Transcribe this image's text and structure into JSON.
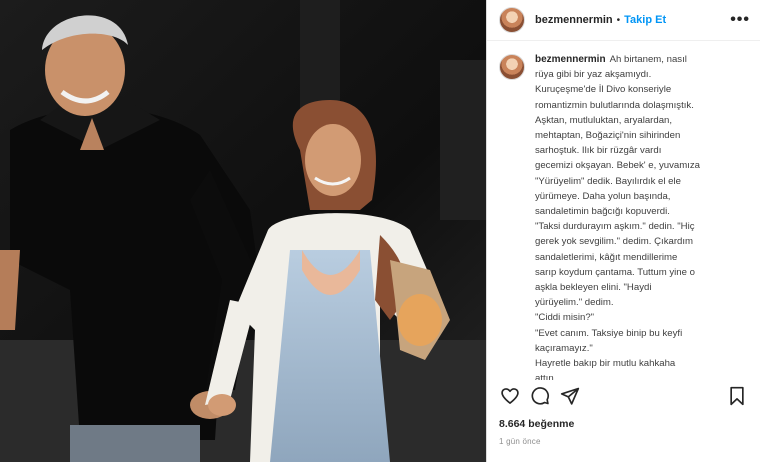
{
  "post": {
    "username": "bezmennermin",
    "separator": "•",
    "follow_label": "Takip Et",
    "more_label": "•••",
    "caption_username": "bezmennermin",
    "caption_lines": [
      "Ah birtanem, nasıl",
      "rüya gibi bir yaz akşamıydı.",
      "Kuruçeşme'de İl Divo konseriyle",
      "romantizmin bulutlarında dolaşmıştık.",
      "Aşktan, mutluluktan, aryalardan,",
      "mehtaptan, Boğaziçi'nin sihirinden",
      "sarhoştuk. Ilık bir rüzgâr vardı",
      "gecemizi okşayan. Bebek' e, yuvamıza",
      "\"Yürüyelim\" dedik. Bayılırdık el ele",
      "yürümeye. Daha yolun başında,",
      "sandaletimin bağcığı kopuverdi.",
      "\"Taksi durdurayım aşkım.\" dedin. \"Hiç",
      "gerek yok sevgilim.\" dedim. Çıkardım",
      "sandaletlerimi, kâğıt mendillerime",
      "sarıp koydum çantama. Tuttum yine o",
      "aşkla bekleyen elini. \"Haydi",
      "yürüyelim.\" dedim.",
      "\"Ciddi misin?\"",
      "\"Evet canım. Taksiye binip bu keyfi",
      "kaçıramayız.\"",
      "Hayretle bakıp bir mutlu kahkaha",
      "attın."
    ],
    "likes": "8.664 beğenme",
    "time_ago": "1 gün önce"
  },
  "icons": {
    "like": "heart-icon",
    "comment": "comment-icon",
    "share": "share-icon",
    "save": "bookmark-icon"
  },
  "colors": {
    "accent": "#0095f6",
    "text": "#262626",
    "muted": "#8e8e8e",
    "border": "#dbdbdb"
  }
}
